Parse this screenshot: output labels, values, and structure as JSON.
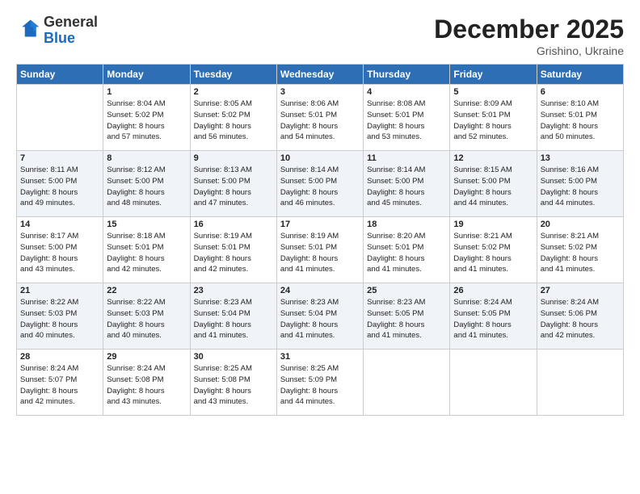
{
  "header": {
    "logo_general": "General",
    "logo_blue": "Blue",
    "month": "December 2025",
    "location": "Grishino, Ukraine"
  },
  "weekdays": [
    "Sunday",
    "Monday",
    "Tuesday",
    "Wednesday",
    "Thursday",
    "Friday",
    "Saturday"
  ],
  "weeks": [
    [
      {
        "day": "",
        "sunrise": "",
        "sunset": "",
        "daylight": ""
      },
      {
        "day": "1",
        "sunrise": "Sunrise: 8:04 AM",
        "sunset": "Sunset: 5:02 PM",
        "daylight": "Daylight: 8 hours and 57 minutes."
      },
      {
        "day": "2",
        "sunrise": "Sunrise: 8:05 AM",
        "sunset": "Sunset: 5:02 PM",
        "daylight": "Daylight: 8 hours and 56 minutes."
      },
      {
        "day": "3",
        "sunrise": "Sunrise: 8:06 AM",
        "sunset": "Sunset: 5:01 PM",
        "daylight": "Daylight: 8 hours and 54 minutes."
      },
      {
        "day": "4",
        "sunrise": "Sunrise: 8:08 AM",
        "sunset": "Sunset: 5:01 PM",
        "daylight": "Daylight: 8 hours and 53 minutes."
      },
      {
        "day": "5",
        "sunrise": "Sunrise: 8:09 AM",
        "sunset": "Sunset: 5:01 PM",
        "daylight": "Daylight: 8 hours and 52 minutes."
      },
      {
        "day": "6",
        "sunrise": "Sunrise: 8:10 AM",
        "sunset": "Sunset: 5:01 PM",
        "daylight": "Daylight: 8 hours and 50 minutes."
      }
    ],
    [
      {
        "day": "7",
        "sunrise": "Sunrise: 8:11 AM",
        "sunset": "Sunset: 5:00 PM",
        "daylight": "Daylight: 8 hours and 49 minutes."
      },
      {
        "day": "8",
        "sunrise": "Sunrise: 8:12 AM",
        "sunset": "Sunset: 5:00 PM",
        "daylight": "Daylight: 8 hours and 48 minutes."
      },
      {
        "day": "9",
        "sunrise": "Sunrise: 8:13 AM",
        "sunset": "Sunset: 5:00 PM",
        "daylight": "Daylight: 8 hours and 47 minutes."
      },
      {
        "day": "10",
        "sunrise": "Sunrise: 8:14 AM",
        "sunset": "Sunset: 5:00 PM",
        "daylight": "Daylight: 8 hours and 46 minutes."
      },
      {
        "day": "11",
        "sunrise": "Sunrise: 8:14 AM",
        "sunset": "Sunset: 5:00 PM",
        "daylight": "Daylight: 8 hours and 45 minutes."
      },
      {
        "day": "12",
        "sunrise": "Sunrise: 8:15 AM",
        "sunset": "Sunset: 5:00 PM",
        "daylight": "Daylight: 8 hours and 44 minutes."
      },
      {
        "day": "13",
        "sunrise": "Sunrise: 8:16 AM",
        "sunset": "Sunset: 5:00 PM",
        "daylight": "Daylight: 8 hours and 44 minutes."
      }
    ],
    [
      {
        "day": "14",
        "sunrise": "Sunrise: 8:17 AM",
        "sunset": "Sunset: 5:00 PM",
        "daylight": "Daylight: 8 hours and 43 minutes."
      },
      {
        "day": "15",
        "sunrise": "Sunrise: 8:18 AM",
        "sunset": "Sunset: 5:01 PM",
        "daylight": "Daylight: 8 hours and 42 minutes."
      },
      {
        "day": "16",
        "sunrise": "Sunrise: 8:19 AM",
        "sunset": "Sunset: 5:01 PM",
        "daylight": "Daylight: 8 hours and 42 minutes."
      },
      {
        "day": "17",
        "sunrise": "Sunrise: 8:19 AM",
        "sunset": "Sunset: 5:01 PM",
        "daylight": "Daylight: 8 hours and 41 minutes."
      },
      {
        "day": "18",
        "sunrise": "Sunrise: 8:20 AM",
        "sunset": "Sunset: 5:01 PM",
        "daylight": "Daylight: 8 hours and 41 minutes."
      },
      {
        "day": "19",
        "sunrise": "Sunrise: 8:21 AM",
        "sunset": "Sunset: 5:02 PM",
        "daylight": "Daylight: 8 hours and 41 minutes."
      },
      {
        "day": "20",
        "sunrise": "Sunrise: 8:21 AM",
        "sunset": "Sunset: 5:02 PM",
        "daylight": "Daylight: 8 hours and 41 minutes."
      }
    ],
    [
      {
        "day": "21",
        "sunrise": "Sunrise: 8:22 AM",
        "sunset": "Sunset: 5:03 PM",
        "daylight": "Daylight: 8 hours and 40 minutes."
      },
      {
        "day": "22",
        "sunrise": "Sunrise: 8:22 AM",
        "sunset": "Sunset: 5:03 PM",
        "daylight": "Daylight: 8 hours and 40 minutes."
      },
      {
        "day": "23",
        "sunrise": "Sunrise: 8:23 AM",
        "sunset": "Sunset: 5:04 PM",
        "daylight": "Daylight: 8 hours and 41 minutes."
      },
      {
        "day": "24",
        "sunrise": "Sunrise: 8:23 AM",
        "sunset": "Sunset: 5:04 PM",
        "daylight": "Daylight: 8 hours and 41 minutes."
      },
      {
        "day": "25",
        "sunrise": "Sunrise: 8:23 AM",
        "sunset": "Sunset: 5:05 PM",
        "daylight": "Daylight: 8 hours and 41 minutes."
      },
      {
        "day": "26",
        "sunrise": "Sunrise: 8:24 AM",
        "sunset": "Sunset: 5:05 PM",
        "daylight": "Daylight: 8 hours and 41 minutes."
      },
      {
        "day": "27",
        "sunrise": "Sunrise: 8:24 AM",
        "sunset": "Sunset: 5:06 PM",
        "daylight": "Daylight: 8 hours and 42 minutes."
      }
    ],
    [
      {
        "day": "28",
        "sunrise": "Sunrise: 8:24 AM",
        "sunset": "Sunset: 5:07 PM",
        "daylight": "Daylight: 8 hours and 42 minutes."
      },
      {
        "day": "29",
        "sunrise": "Sunrise: 8:24 AM",
        "sunset": "Sunset: 5:08 PM",
        "daylight": "Daylight: 8 hours and 43 minutes."
      },
      {
        "day": "30",
        "sunrise": "Sunrise: 8:25 AM",
        "sunset": "Sunset: 5:08 PM",
        "daylight": "Daylight: 8 hours and 43 minutes."
      },
      {
        "day": "31",
        "sunrise": "Sunrise: 8:25 AM",
        "sunset": "Sunset: 5:09 PM",
        "daylight": "Daylight: 8 hours and 44 minutes."
      },
      {
        "day": "",
        "sunrise": "",
        "sunset": "",
        "daylight": ""
      },
      {
        "day": "",
        "sunrise": "",
        "sunset": "",
        "daylight": ""
      },
      {
        "day": "",
        "sunrise": "",
        "sunset": "",
        "daylight": ""
      }
    ]
  ]
}
